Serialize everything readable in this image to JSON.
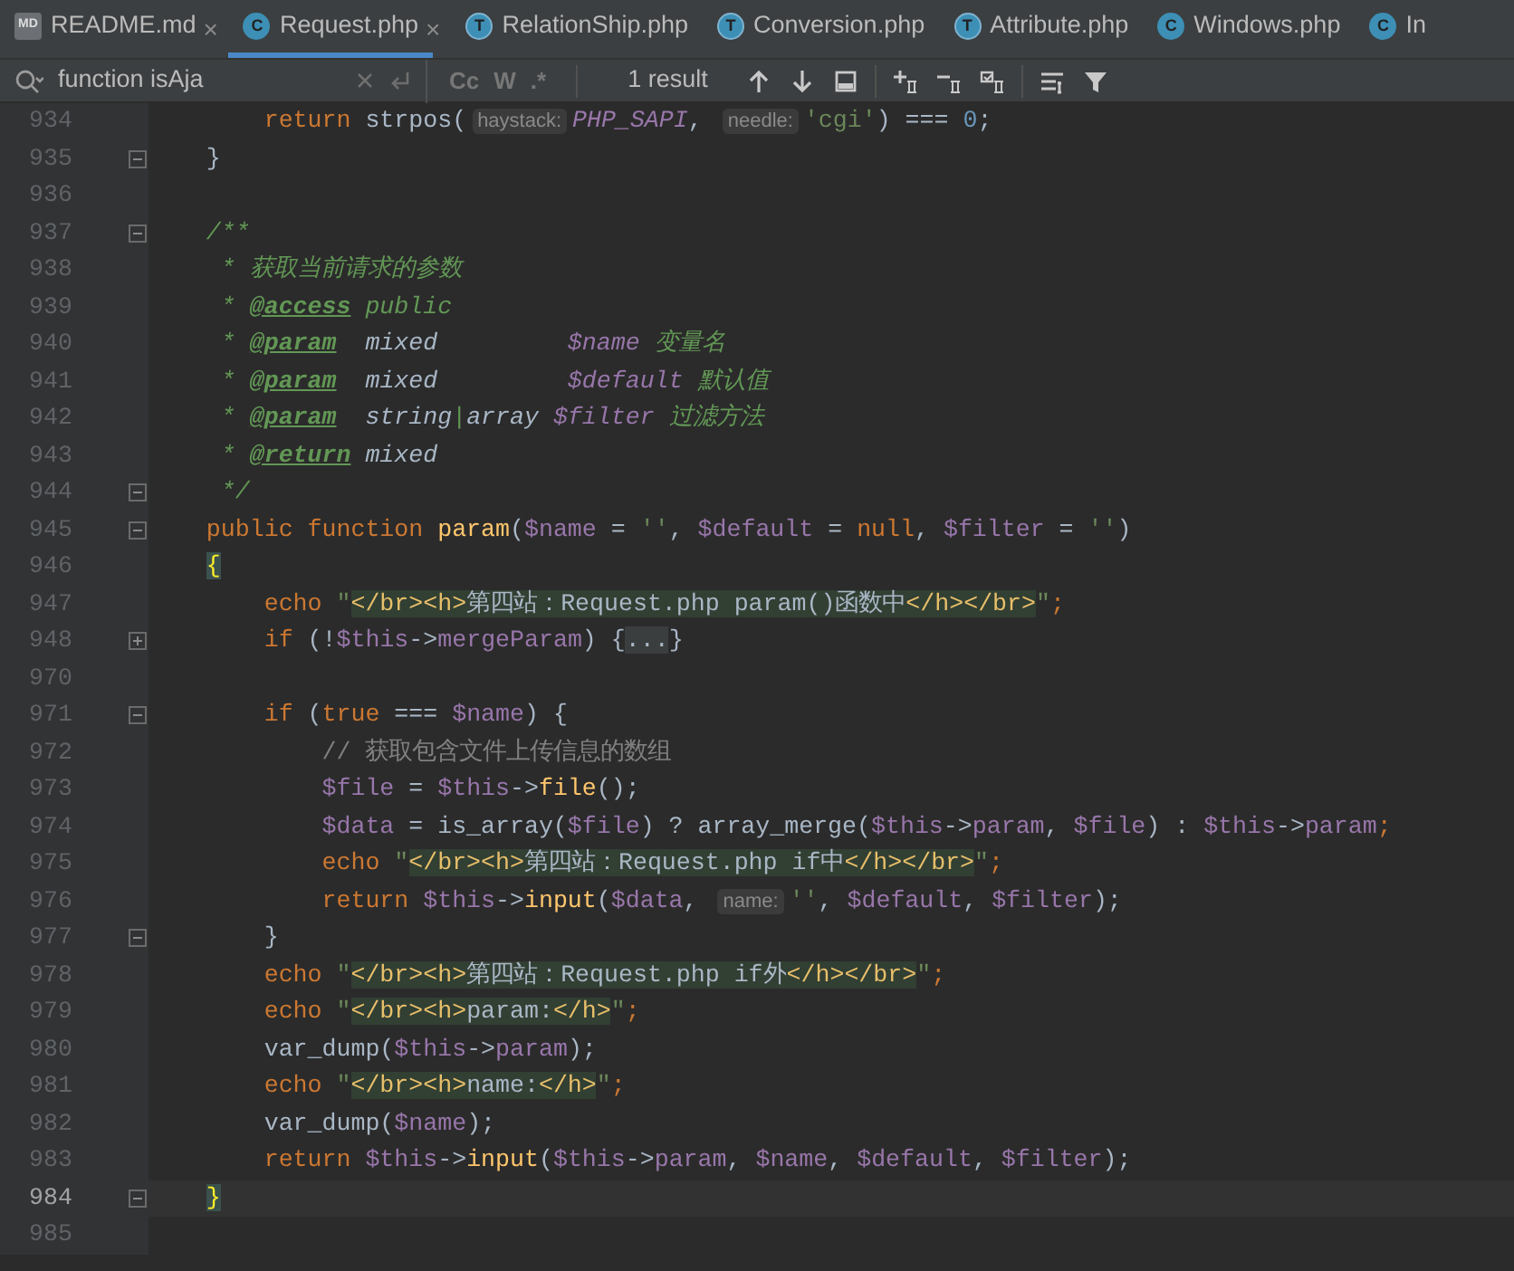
{
  "tabs": [
    {
      "label": "README.md",
      "kind": "markdown",
      "icon_text": "MD",
      "selected": false,
      "close_glyph": "×"
    },
    {
      "label": "Request.php",
      "kind": "class",
      "icon_text": "C",
      "selected": true,
      "close_glyph": "×"
    },
    {
      "label": "RelationShip.php",
      "kind": "trait",
      "icon_text": "T",
      "selected": false
    },
    {
      "label": "Conversion.php",
      "kind": "trait",
      "icon_text": "T",
      "selected": false
    },
    {
      "label": "Attribute.php",
      "kind": "trait",
      "icon_text": "T",
      "selected": false
    },
    {
      "label": "Windows.php",
      "kind": "class",
      "icon_text": "C",
      "selected": false
    },
    {
      "label": "In",
      "kind": "class",
      "icon_text": "C",
      "selected": false
    }
  ],
  "search": {
    "query": "function isAja",
    "options": [
      "Cc",
      "W",
      ".*"
    ],
    "result": "1 result"
  },
  "lines": [
    {
      "number": "934",
      "current": false,
      "tokens": [
        {
          "kind": "kw",
          "text": "        return"
        },
        {
          "kind": "plain",
          "text": " strpos("
        },
        {
          "kind": "hint",
          "text": "haystack:"
        },
        {
          "kind": "const",
          "text": "PHP_SAPI"
        },
        {
          "kind": "plain",
          "text": ", "
        },
        {
          "kind": "hint",
          "text": "needle:"
        },
        {
          "kind": "str",
          "text": "'cgi'"
        },
        {
          "kind": "plain",
          "text": ") === "
        },
        {
          "kind": "num",
          "text": "0"
        },
        {
          "kind": "plain",
          "text": ";"
        }
      ]
    },
    {
      "number": "935",
      "fold": {
        "kind": "end"
      },
      "current": false,
      "tokens": [
        {
          "kind": "plain",
          "text": "    }"
        }
      ]
    },
    {
      "number": "936",
      "current": false
    },
    {
      "number": "937",
      "fold": {
        "kind": "start"
      },
      "current": false,
      "tokens": [
        {
          "kind": "doc",
          "text": "    /**"
        }
      ]
    },
    {
      "number": "938",
      "current": false,
      "tokens": [
        {
          "kind": "doc",
          "text": "     * 获取当前请求的参数"
        }
      ]
    },
    {
      "number": "939",
      "current": false,
      "tokens": [
        {
          "kind": "doc",
          "text": "     * "
        },
        {
          "kind": "doctag",
          "text": "@access"
        },
        {
          "kind": "doc",
          "text": " public"
        }
      ]
    },
    {
      "number": "940",
      "current": false,
      "tokens": [
        {
          "kind": "doc",
          "text": "     * "
        },
        {
          "kind": "doctag",
          "text": "@param"
        },
        {
          "kind": "doctype",
          "text": "  mixed        "
        },
        {
          "kind": "docvar",
          "text": " $name"
        },
        {
          "kind": "doc",
          "text": " 变量名"
        }
      ]
    },
    {
      "number": "941",
      "current": false,
      "tokens": [
        {
          "kind": "doc",
          "text": "     * "
        },
        {
          "kind": "doctag",
          "text": "@param"
        },
        {
          "kind": "doctype",
          "text": "  mixed        "
        },
        {
          "kind": "docvar",
          "text": " $default"
        },
        {
          "kind": "doc",
          "text": " 默认值"
        }
      ]
    },
    {
      "number": "942",
      "current": false,
      "tokens": [
        {
          "kind": "doc",
          "text": "     * "
        },
        {
          "kind": "doctag",
          "text": "@param"
        },
        {
          "kind": "doctype",
          "text": "  string"
        },
        {
          "kind": "doc",
          "text": "|"
        },
        {
          "kind": "doctype",
          "text": "array"
        },
        {
          "kind": "docvar",
          "text": " $filter"
        },
        {
          "kind": "doc",
          "text": " 过滤方法"
        }
      ]
    },
    {
      "number": "943",
      "current": false,
      "tokens": [
        {
          "kind": "doc",
          "text": "     * "
        },
        {
          "kind": "doctag",
          "text": "@return"
        },
        {
          "kind": "doctype",
          "text": " mixed"
        }
      ]
    },
    {
      "number": "944",
      "fold": {
        "kind": "end"
      },
      "current": false,
      "tokens": [
        {
          "kind": "doc",
          "text": "     */"
        }
      ]
    },
    {
      "number": "945",
      "fold": {
        "kind": "start"
      },
      "current": false,
      "tokens": [
        {
          "kind": "kw",
          "text": "    public function "
        },
        {
          "kind": "fn",
          "text": "param"
        },
        {
          "kind": "plain",
          "text": "("
        },
        {
          "kind": "var",
          "text": "$name"
        },
        {
          "kind": "plain",
          "text": " = "
        },
        {
          "kind": "str",
          "text": "''"
        },
        {
          "kind": "plain",
          "text": ", "
        },
        {
          "kind": "var",
          "text": "$default"
        },
        {
          "kind": "plain",
          "text": " = "
        },
        {
          "kind": "kw",
          "text": "null"
        },
        {
          "kind": "plain",
          "text": ", "
        },
        {
          "kind": "var",
          "text": "$filter"
        },
        {
          "kind": "plain",
          "text": " = "
        },
        {
          "kind": "str",
          "text": "''"
        },
        {
          "kind": "plain",
          "text": ")"
        }
      ]
    },
    {
      "number": "946",
      "current": false,
      "tokens": [
        {
          "kind": "brace",
          "text": "    {"
        }
      ]
    },
    {
      "number": "947",
      "current": false,
      "tokens": [
        {
          "kind": "kw",
          "text": "        echo "
        },
        {
          "kind": "str",
          "text": "\""
        },
        {
          "kind": "tag",
          "text": "</br><h>"
        },
        {
          "kind": "inj",
          "text": "第四站：Request.php param()函数中"
        },
        {
          "kind": "tag",
          "text": "</h></br>"
        },
        {
          "kind": "str",
          "text": "\""
        },
        {
          "kind": "kw",
          "text": ";"
        }
      ]
    },
    {
      "number": "948",
      "fold": {
        "kind": "collapsed"
      },
      "current": false,
      "tokens": [
        {
          "kind": "kw",
          "text": "        if "
        },
        {
          "kind": "plain",
          "text": "(!"
        },
        {
          "kind": "var",
          "text": "$this"
        },
        {
          "kind": "plain",
          "text": "->"
        },
        {
          "kind": "var",
          "text": "mergeParam"
        },
        {
          "kind": "plain",
          "text": ") {"
        },
        {
          "kind": "folded",
          "text": "..."
        },
        {
          "kind": "plain",
          "text": "}"
        }
      ]
    },
    {
      "number": "970",
      "current": false
    },
    {
      "number": "971",
      "fold": {
        "kind": "start"
      },
      "current": false,
      "tokens": [
        {
          "kind": "kw",
          "text": "        if "
        },
        {
          "kind": "plain",
          "text": "("
        },
        {
          "kind": "kw",
          "text": "true"
        },
        {
          "kind": "plain",
          "text": " === "
        },
        {
          "kind": "var",
          "text": "$name"
        },
        {
          "kind": "plain",
          "text": ") {"
        }
      ]
    },
    {
      "number": "972",
      "current": false,
      "tokens": [
        {
          "kind": "cmt",
          "text": "            // 获取包含文件上传信息的数组"
        }
      ]
    },
    {
      "number": "973",
      "current": false,
      "tokens": [
        {
          "kind": "var",
          "text": "            $file"
        },
        {
          "kind": "plain",
          "text": " = "
        },
        {
          "kind": "var",
          "text": "$this"
        },
        {
          "kind": "plain",
          "text": "->"
        },
        {
          "kind": "fn",
          "text": "file"
        },
        {
          "kind": "plain",
          "text": "();"
        }
      ]
    },
    {
      "number": "974",
      "current": false,
      "tokens": [
        {
          "kind": "var",
          "text": "            $data"
        },
        {
          "kind": "plain",
          "text": " = is_array("
        },
        {
          "kind": "var",
          "text": "$file"
        },
        {
          "kind": "plain",
          "text": ") ? array_merge("
        },
        {
          "kind": "var",
          "text": "$this"
        },
        {
          "kind": "plain",
          "text": "->"
        },
        {
          "kind": "var",
          "text": "param"
        },
        {
          "kind": "plain",
          "text": ", "
        },
        {
          "kind": "var",
          "text": "$file"
        },
        {
          "kind": "plain",
          "text": ") : "
        },
        {
          "kind": "var",
          "text": "$this"
        },
        {
          "kind": "plain",
          "text": "->"
        },
        {
          "kind": "var",
          "text": "param"
        },
        {
          "kind": "kw",
          "text": ";"
        }
      ]
    },
    {
      "number": "975",
      "current": false,
      "tokens": [
        {
          "kind": "kw",
          "text": "            echo "
        },
        {
          "kind": "str",
          "text": "\""
        },
        {
          "kind": "tag",
          "text": "</br><h>"
        },
        {
          "kind": "inj",
          "text": "第四站：Request.php if中"
        },
        {
          "kind": "tag",
          "text": "</h></br>"
        },
        {
          "kind": "str",
          "text": "\""
        },
        {
          "kind": "kw",
          "text": ";"
        }
      ]
    },
    {
      "number": "976",
      "current": false,
      "tokens": [
        {
          "kind": "kw",
          "text": "            return "
        },
        {
          "kind": "var",
          "text": "$this"
        },
        {
          "kind": "plain",
          "text": "->"
        },
        {
          "kind": "fn",
          "text": "input"
        },
        {
          "kind": "plain",
          "text": "("
        },
        {
          "kind": "var",
          "text": "$data"
        },
        {
          "kind": "plain",
          "text": ", "
        },
        {
          "kind": "hint",
          "text": "name:"
        },
        {
          "kind": "str",
          "text": "''"
        },
        {
          "kind": "plain",
          "text": ", "
        },
        {
          "kind": "var",
          "text": "$default"
        },
        {
          "kind": "plain",
          "text": ", "
        },
        {
          "kind": "var",
          "text": "$filter"
        },
        {
          "kind": "plain",
          "text": ");"
        }
      ]
    },
    {
      "number": "977",
      "fold": {
        "kind": "end"
      },
      "current": false,
      "tokens": [
        {
          "kind": "plain",
          "text": "        }"
        }
      ]
    },
    {
      "number": "978",
      "current": false,
      "tokens": [
        {
          "kind": "kw",
          "text": "        echo "
        },
        {
          "kind": "str",
          "text": "\""
        },
        {
          "kind": "tag",
          "text": "</br><h>"
        },
        {
          "kind": "inj",
          "text": "第四站：Request.php if外"
        },
        {
          "kind": "tag",
          "text": "</h></br>"
        },
        {
          "kind": "str",
          "text": "\""
        },
        {
          "kind": "kw",
          "text": ";"
        }
      ]
    },
    {
      "number": "979",
      "current": false,
      "tokens": [
        {
          "kind": "kw",
          "text": "        echo "
        },
        {
          "kind": "str",
          "text": "\""
        },
        {
          "kind": "tag",
          "text": "</br><h>"
        },
        {
          "kind": "inj",
          "text": "param:"
        },
        {
          "kind": "tag",
          "text": "</h>"
        },
        {
          "kind": "str",
          "text": "\""
        },
        {
          "kind": "kw",
          "text": ";"
        }
      ]
    },
    {
      "number": "980",
      "current": false,
      "tokens": [
        {
          "kind": "plain",
          "text": "        var_dump("
        },
        {
          "kind": "var",
          "text": "$this"
        },
        {
          "kind": "plain",
          "text": "->"
        },
        {
          "kind": "var",
          "text": "param"
        },
        {
          "kind": "plain",
          "text": ");"
        }
      ]
    },
    {
      "number": "981",
      "current": false,
      "tokens": [
        {
          "kind": "kw",
          "text": "        echo "
        },
        {
          "kind": "str",
          "text": "\""
        },
        {
          "kind": "tag",
          "text": "</br><h>"
        },
        {
          "kind": "inj",
          "text": "name:"
        },
        {
          "kind": "tag",
          "text": "</h>"
        },
        {
          "kind": "str",
          "text": "\""
        },
        {
          "kind": "kw",
          "text": ";"
        }
      ]
    },
    {
      "number": "982",
      "current": false,
      "tokens": [
        {
          "kind": "plain",
          "text": "        var_dump("
        },
        {
          "kind": "var",
          "text": "$name"
        },
        {
          "kind": "plain",
          "text": ");"
        }
      ]
    },
    {
      "number": "983",
      "current": false,
      "tokens": [
        {
          "kind": "kw",
          "text": "        return "
        },
        {
          "kind": "var",
          "text": "$this"
        },
        {
          "kind": "plain",
          "text": "->"
        },
        {
          "kind": "fn",
          "text": "input"
        },
        {
          "kind": "plain",
          "text": "("
        },
        {
          "kind": "var",
          "text": "$this"
        },
        {
          "kind": "plain",
          "text": "->"
        },
        {
          "kind": "var",
          "text": "param"
        },
        {
          "kind": "plain",
          "text": ", "
        },
        {
          "kind": "var",
          "text": "$name"
        },
        {
          "kind": "plain",
          "text": ", "
        },
        {
          "kind": "var",
          "text": "$default"
        },
        {
          "kind": "plain",
          "text": ", "
        },
        {
          "kind": "var",
          "text": "$filter"
        },
        {
          "kind": "plain",
          "text": ");"
        }
      ]
    },
    {
      "number": "984",
      "fold": {
        "kind": "end"
      },
      "current": true,
      "tokens": [
        {
          "kind": "brace",
          "text": "    }"
        }
      ]
    },
    {
      "number": "985",
      "current": false
    }
  ]
}
